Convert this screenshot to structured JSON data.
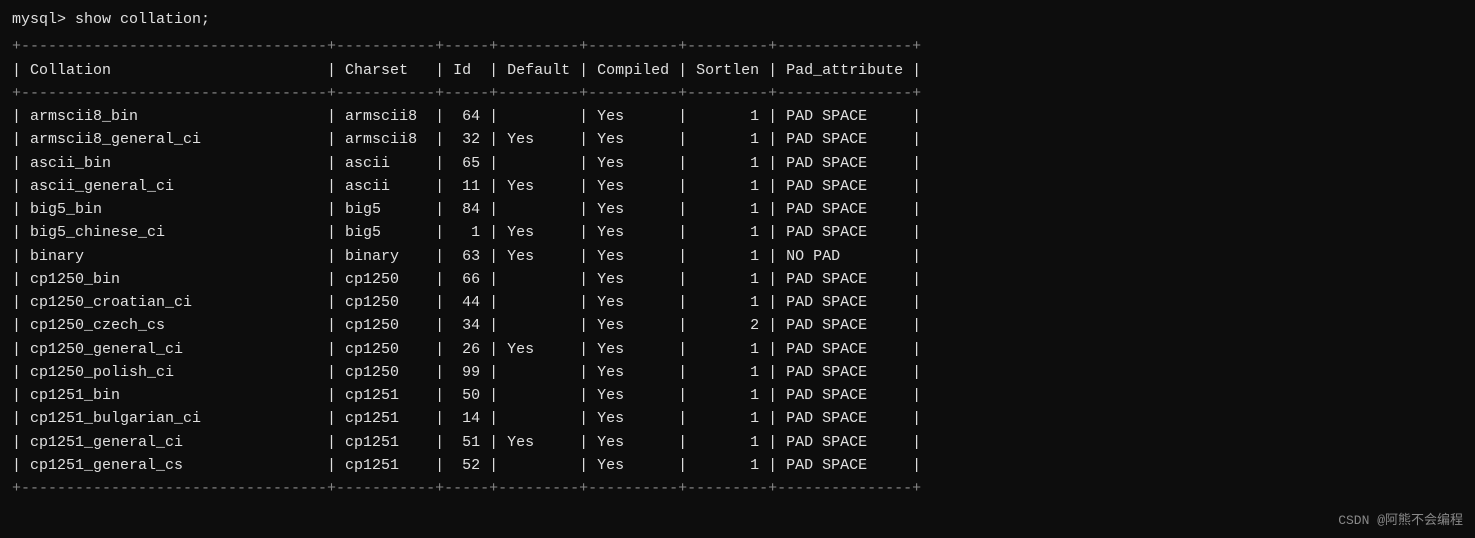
{
  "terminal": {
    "prompt": "mysql> show collation;",
    "separator_top": "+----------------------------------+-----------+-----+---------+----------+---------+---------------+",
    "header": "| Collation                        | Charset   | Id  | Default | Compiled | Sortlen | Pad_attribute |",
    "separator_mid": "+----------------------------------+-----------+-----+---------+----------+---------+---------------+",
    "rows": [
      "| armscii8_bin                     | armscii8  |  64 |         | Yes      |       1 | PAD SPACE     |",
      "| armscii8_general_ci              | armscii8  |  32 | Yes     | Yes      |       1 | PAD SPACE     |",
      "| ascii_bin                        | ascii     |  65 |         | Yes      |       1 | PAD SPACE     |",
      "| ascii_general_ci                 | ascii     |  11 | Yes     | Yes      |       1 | PAD SPACE     |",
      "| big5_bin                         | big5      |  84 |         | Yes      |       1 | PAD SPACE     |",
      "| big5_chinese_ci                  | big5      |   1 | Yes     | Yes      |       1 | PAD SPACE     |",
      "| binary                           | binary    |  63 | Yes     | Yes      |       1 | NO PAD        |",
      "| cp1250_bin                       | cp1250    |  66 |         | Yes      |       1 | PAD SPACE     |",
      "| cp1250_croatian_ci               | cp1250    |  44 |         | Yes      |       1 | PAD SPACE     |",
      "| cp1250_czech_cs                  | cp1250    |  34 |         | Yes      |       2 | PAD SPACE     |",
      "| cp1250_general_ci                | cp1250    |  26 | Yes     | Yes      |       1 | PAD SPACE     |",
      "| cp1250_polish_ci                 | cp1250    |  99 |         | Yes      |       1 | PAD SPACE     |",
      "| cp1251_bin                       | cp1251    |  50 |         | Yes      |       1 | PAD SPACE     |",
      "| cp1251_bulgarian_ci              | cp1251    |  14 |         | Yes      |       1 | PAD SPACE     |",
      "| cp1251_general_ci                | cp1251    |  51 | Yes     | Yes      |       1 | PAD SPACE     |",
      "| cp1251_general_cs                | cp1251    |  52 |         | Yes      |       1 | PAD SPACE     |"
    ],
    "separator_bottom": "+----------------------------------+-----------+-----+---------+----------+---------+---------------+"
  },
  "watermark": {
    "text": "CSDN @阿熊不会编程"
  }
}
